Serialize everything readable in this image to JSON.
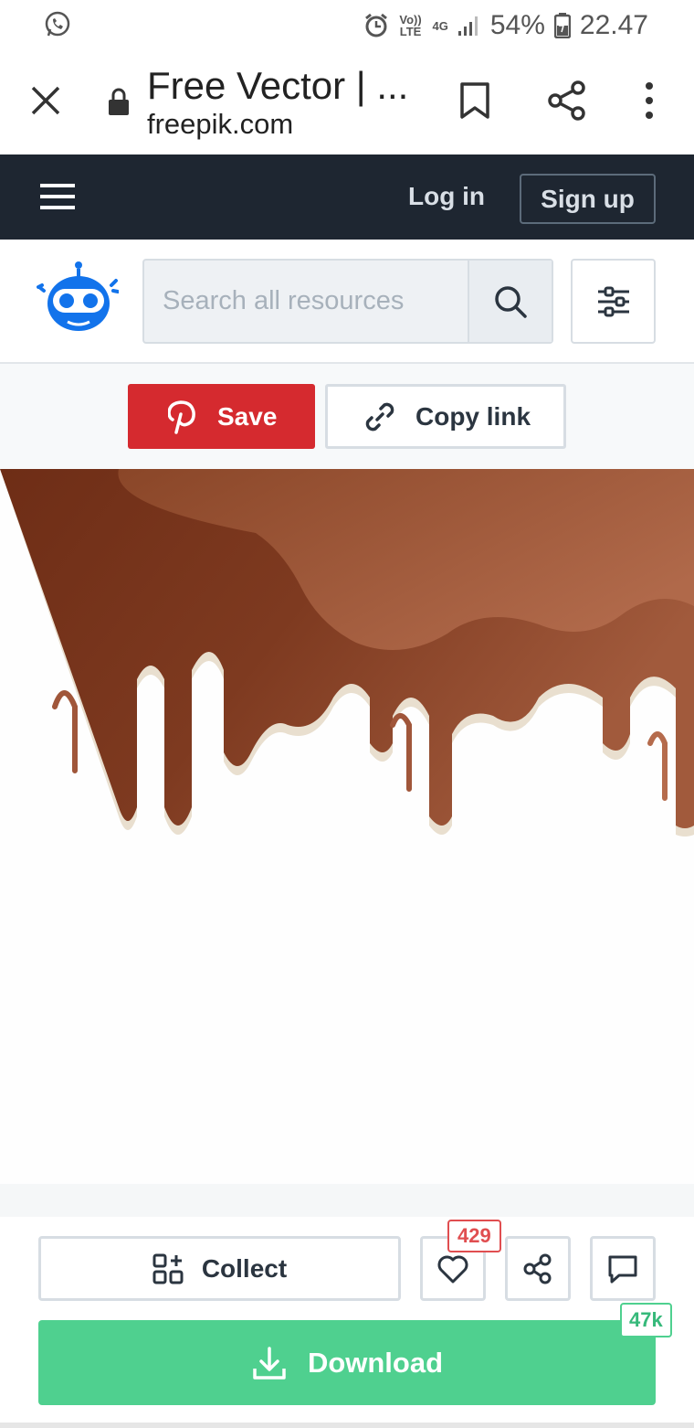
{
  "status_bar": {
    "net_volte": "Vo)) LTE",
    "net_type": "4G",
    "battery": "54%",
    "time": "22.47",
    "icons": [
      "whatsapp-icon",
      "alarm-icon",
      "signal-icon",
      "battery-icon"
    ]
  },
  "browser": {
    "title": "Free Vector | ...",
    "url": "freepik.com"
  },
  "header": {
    "login_label": "Log in",
    "signup_label": "Sign up",
    "bg_color": "#1e2631"
  },
  "search": {
    "placeholder": "Search all resources"
  },
  "share": {
    "save_label": "Save",
    "copy_label": "Copy link",
    "save_color": "#d52a2f"
  },
  "actions": {
    "collect_label": "Collect",
    "like_count": "429",
    "download_label": "Download",
    "download_count": "47k",
    "download_color": "#4fd08f"
  }
}
